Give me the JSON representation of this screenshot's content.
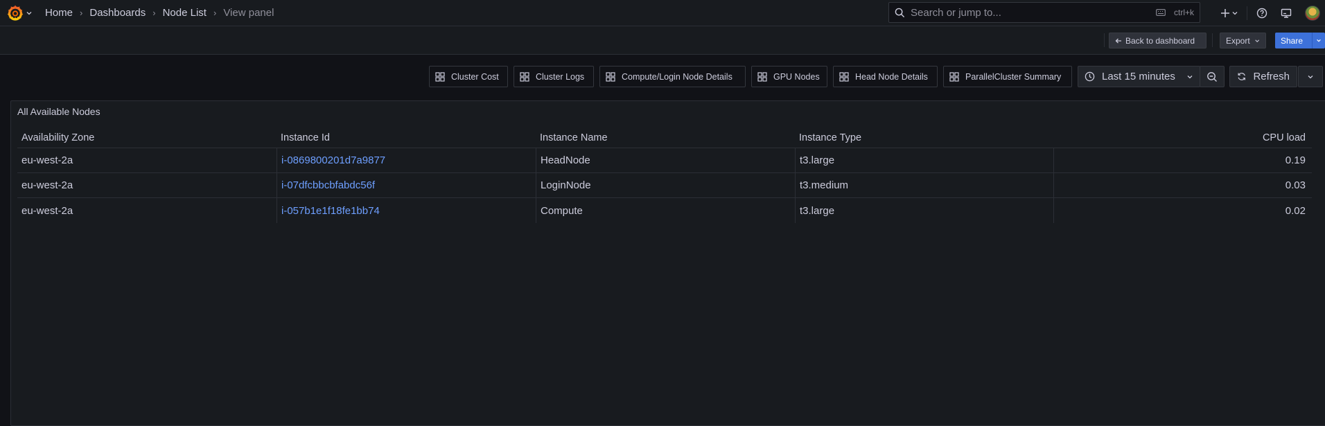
{
  "colors": {
    "background": "#111217",
    "panel": "#181b1f",
    "border": "#2c2f36",
    "text": "#ccccdc",
    "muted": "#8e8e99",
    "link": "#6e9fff",
    "primary": "#3d71d9",
    "logo": "#f46800"
  },
  "breadcrumb": [
    "Home",
    "Dashboards",
    "Node List",
    "View panel"
  ],
  "search": {
    "placeholder": "Search or jump to...",
    "shortcut": "ctrl+k"
  },
  "toolbar": {
    "back_label": "Back to dashboard",
    "export_label": "Export",
    "share_label": "Share"
  },
  "dashboard_links": [
    "Cluster Cost",
    "Cluster Logs",
    "Compute/Login Node Details",
    "GPU Nodes",
    "Head Node Details",
    "ParallelCluster Summary"
  ],
  "time_picker": {
    "label": "Last 15 minutes"
  },
  "refresh": {
    "label": "Refresh"
  },
  "panel": {
    "title": "All Available Nodes",
    "columns": [
      "Availability Zone",
      "Instance Id",
      "Instance Name",
      "Instance Type",
      "CPU load"
    ],
    "rows": [
      [
        "eu-west-2a",
        "i-0869800201d7a9877",
        "HeadNode",
        "t3.large",
        "0.19"
      ],
      [
        "eu-west-2a",
        "i-07dfcbbcbfabdc56f",
        "LoginNode",
        "t3.medium",
        "0.03"
      ],
      [
        "eu-west-2a",
        "i-057b1e1f18fe1bb74",
        "Compute",
        "t3.large",
        "0.02"
      ]
    ]
  },
  "icons": {
    "logo": "grafana-logo-icon",
    "search": "search-icon",
    "keyboard": "keyboard-icon",
    "add": "plus-icon",
    "help": "help-circle-icon",
    "news": "monitor-icon",
    "dashboard_link": "apps-grid-icon",
    "clock": "clock-icon",
    "zoom": "zoom-out-icon",
    "refresh": "refresh-icon"
  }
}
